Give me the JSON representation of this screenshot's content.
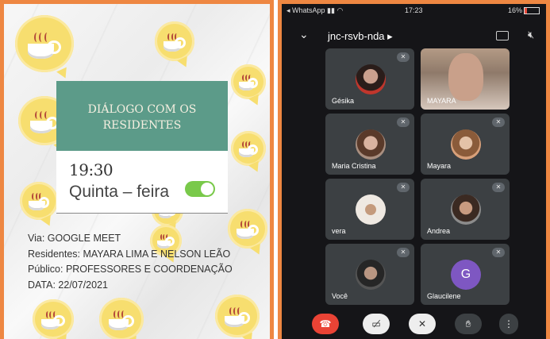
{
  "poster": {
    "title_line1": "DIÁLOGO COM OS",
    "title_line2": "RESIDENTES",
    "time": "19:30",
    "weekday": "Quinta – feira",
    "details": [
      "Via: GOOGLE MEET",
      "Residentes: MAYARA LIMA E NELSON LEÃO",
      "Público: PROFESSORES E COORDENAÇÃO",
      "DATA: 22/07/2021"
    ],
    "accent_color": "#5c9b89",
    "border_color": "#ee8742",
    "bubble_color": "#f7de6f",
    "toggle_on": true
  },
  "phone": {
    "status": {
      "back_app": "◂ WhatsApp",
      "time": "17:23",
      "battery": "16%"
    },
    "meeting_code": "jnc-rsvb-nda ▸",
    "participants": [
      {
        "name": "Gésika",
        "muted": true
      },
      {
        "name": "MAYARA",
        "muted": false,
        "video": true
      },
      {
        "name": "Maria Cristina",
        "muted": true
      },
      {
        "name": "Mayara",
        "muted": true
      },
      {
        "name": "vera",
        "muted": true
      },
      {
        "name": "Andrea",
        "muted": true
      },
      {
        "name": "Você",
        "muted": true
      },
      {
        "name": "Glaucilene",
        "muted": true,
        "initial": "G"
      }
    ],
    "controls": [
      "hang-up",
      "camera-off",
      "mic-off",
      "raise-hand",
      "more"
    ]
  }
}
